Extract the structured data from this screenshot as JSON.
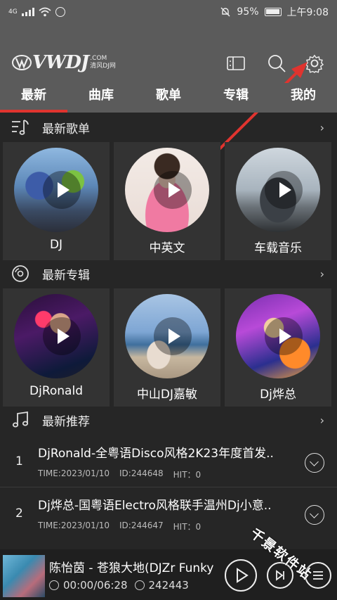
{
  "status_bar": {
    "network": "4G",
    "battery": "95%",
    "time": "上午9:08"
  },
  "header": {
    "logo_text": "VWDJ",
    "logo_domain": ".COM",
    "logo_cn": "清风DJ网"
  },
  "tabs": [
    {
      "label": "最新",
      "active": true
    },
    {
      "label": "曲库"
    },
    {
      "label": "歌单"
    },
    {
      "label": "专辑"
    },
    {
      "label": "我的"
    }
  ],
  "section_playlists": {
    "title": "最新歌单",
    "more": "›",
    "items": [
      {
        "label": "DJ"
      },
      {
        "label": "中英文"
      },
      {
        "label": "车载音乐"
      }
    ]
  },
  "section_albums": {
    "title": "最新专辑",
    "more": "›",
    "items": [
      {
        "label": "DjRonald"
      },
      {
        "label": "中山DJ嘉敏"
      },
      {
        "label": "Dj烨总"
      }
    ]
  },
  "section_recommend": {
    "title": "最新推荐",
    "more": "›",
    "rows": [
      {
        "num": "1",
        "title": "DjRonald-全粤语Disco风格2K23年度首发..",
        "time": "TIME:2023/01/10",
        "id": "ID:244648",
        "hit": "HIT：0"
      },
      {
        "num": "2",
        "title": "Dj烨总-国粤语Electro风格联手温州Dj小意..",
        "time": "TIME:2023/01/10",
        "id": "ID:244647",
        "hit": "HIT：0"
      }
    ]
  },
  "player": {
    "title": "陈怡茵 - 苍狼大地(DJZr Funky",
    "position": "00:00/06:28",
    "track_id": "242443"
  },
  "watermark": "千景软件站",
  "accent_color": "#e0342f"
}
